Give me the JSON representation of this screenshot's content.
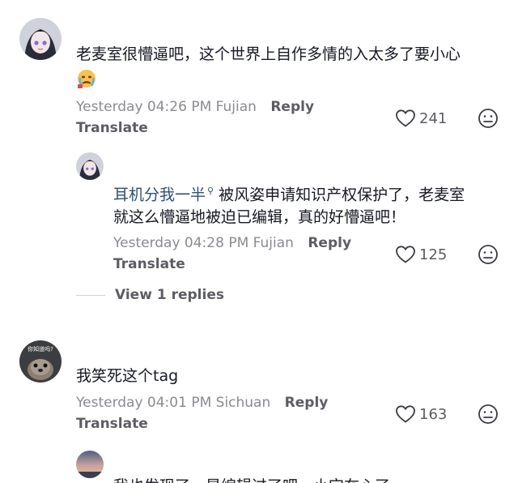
{
  "comments": [
    {
      "text": "老麦室很懵逼吧，这个世界上自作多情的入太多了要小心",
      "meta": "Yesterday 04:26 PM Fujian",
      "reply_label": "Reply",
      "translate_label": "Translate",
      "likes": "241"
    },
    {
      "author": "耳机分我一半",
      "text_line1": "被风姿申请知识产权保护了，老麦室",
      "text_line2": "就这么懵逼地被迫已编辑，真的好懵逼吧！",
      "meta": "Yesterday 04:28 PM Fujian",
      "reply_label": "Reply",
      "translate_label": "Translate",
      "likes": "125"
    },
    {
      "text": "我笑死这个tag",
      "meta": "Yesterday 04:01 PM Sichuan",
      "reply_label": "Reply",
      "translate_label": "Translate",
      "likes": "163",
      "avatar_caption": "你知道吗?"
    },
    {
      "text": "我也发现了，是编辑过了吧，小宝在心了"
    }
  ],
  "view_replies_label": "View 1 replies",
  "colors": {
    "text": "#161823",
    "meta": "#8a8b91",
    "action": "#5c5d63",
    "author": "#2f4f7a"
  }
}
